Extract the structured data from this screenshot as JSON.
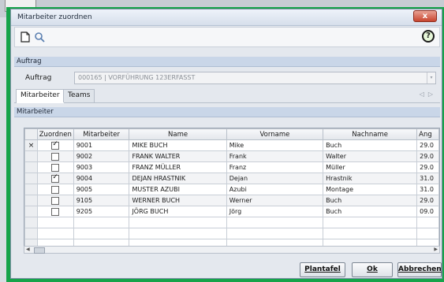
{
  "background": {
    "button_label": ""
  },
  "window": {
    "title": "Mitarbeiter zuordnen",
    "close_glyph": "x"
  },
  "toolbar": {
    "icons": [
      "new-document-icon",
      "search-icon"
    ],
    "help_glyph": "?"
  },
  "auftrag_section": {
    "header": "Auftrag",
    "label": "Auftrag",
    "value": "000165 | VORFÜHRUNG 123ERFASST"
  },
  "tabs": [
    {
      "label": "Mitarbeiter",
      "active": true
    },
    {
      "label": "Teams",
      "active": false
    }
  ],
  "tab_nav": {
    "prev": "◁",
    "next": "▷"
  },
  "grid_section": {
    "header": "Mitarbeiter"
  },
  "grid": {
    "columns": [
      "Zuordnen",
      "Mitarbeiter",
      "Name",
      "Vorname",
      "Nachname",
      "Ang"
    ],
    "rows": [
      {
        "marker": "×",
        "checked": true,
        "mitarbeiter": "9001",
        "name": "MIKE BUCH",
        "vorname": "Mike",
        "nachname": "Buch",
        "ang": "29.0"
      },
      {
        "marker": "",
        "checked": false,
        "mitarbeiter": "9002",
        "name": "FRANK WALTER",
        "vorname": "Frank",
        "nachname": "Walter",
        "ang": "29.0"
      },
      {
        "marker": "",
        "checked": false,
        "mitarbeiter": "9003",
        "name": "FRANZ MÜLLER",
        "vorname": "Franz",
        "nachname": "Müller",
        "ang": "29.0"
      },
      {
        "marker": "",
        "checked": true,
        "mitarbeiter": "9004",
        "name": "DEJAN HRASTNIK",
        "vorname": "Dejan",
        "nachname": "Hrastnik",
        "ang": "31.0"
      },
      {
        "marker": "",
        "checked": false,
        "mitarbeiter": "9005",
        "name": "MUSTER AZUBI",
        "vorname": "Azubi",
        "nachname": "Montage",
        "ang": "31.0"
      },
      {
        "marker": "",
        "checked": false,
        "mitarbeiter": "9105",
        "name": "WERNER BUCH",
        "vorname": "Werner",
        "nachname": "Buch",
        "ang": "29.0"
      },
      {
        "marker": "",
        "checked": false,
        "mitarbeiter": "9205",
        "name": "JÖRG BUCH",
        "vorname": "Jörg",
        "nachname": "Buch",
        "ang": "09.0"
      }
    ]
  },
  "buttons": {
    "plantafel": "Plantafel",
    "ok": "Ok",
    "abbrechen": "Abbrechen"
  },
  "colors": {
    "highlight_frame": "#16a34a",
    "section_header": "#c9d6e8"
  }
}
